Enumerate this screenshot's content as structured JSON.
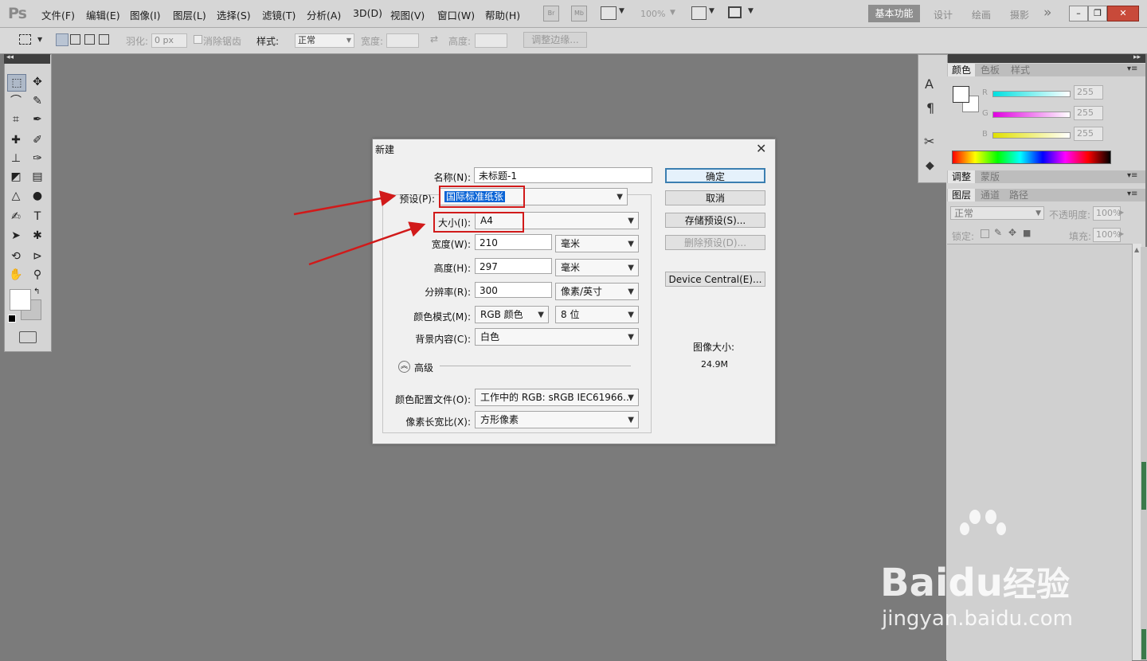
{
  "app": {
    "logo": "Ps"
  },
  "menubar": {
    "items": [
      "文件(F)",
      "编辑(E)",
      "图像(I)",
      "图层(L)",
      "选择(S)",
      "滤镜(T)",
      "分析(A)",
      "3D(D)",
      "视图(V)",
      "窗口(W)",
      "帮助(H)"
    ],
    "bridge_label": "Br",
    "minibridge_label": "Mb",
    "zoom": "100%",
    "workspaces": {
      "active": "基本功能",
      "others": [
        "设计",
        "绘画",
        "摄影"
      ]
    },
    "more": "»"
  },
  "options": {
    "feather_label": "羽化:",
    "feather_value": "0 px",
    "antialias_label": "消除锯齿",
    "style_label": "样式:",
    "style_value": "正常",
    "width_label": "宽度:",
    "height_label": "高度:",
    "refine_edge": "调整边缘..."
  },
  "right_panels": {
    "color_tabs": [
      "颜色",
      "色板",
      "样式"
    ],
    "r_label": "R",
    "g_label": "G",
    "b_label": "B",
    "r_value": "255",
    "g_value": "255",
    "b_value": "255",
    "adjust_tabs": [
      "调整",
      "蒙版"
    ],
    "layer_tabs": [
      "图层",
      "通道",
      "路径"
    ],
    "blend_mode": "正常",
    "opacity_label": "不透明度:",
    "opacity_value": "100%",
    "lock_label": "锁定:",
    "fill_label": "填充:",
    "fill_value": "100%"
  },
  "dialog": {
    "title": "新建",
    "name_label": "名称(N):",
    "name_value": "未标题-1",
    "preset_label": "预设(P):",
    "preset_value": "国际标准纸张",
    "size_label": "大小(I):",
    "size_value": "A4",
    "width_label": "宽度(W):",
    "width_value": "210",
    "width_unit": "毫米",
    "height_label": "高度(H):",
    "height_value": "297",
    "height_unit": "毫米",
    "resolution_label": "分辨率(R):",
    "resolution_value": "300",
    "resolution_unit": "像素/英寸",
    "color_mode_label": "颜色模式(M):",
    "color_mode_value": "RGB 颜色",
    "bit_depth_value": "8 位",
    "background_label": "背景内容(C):",
    "background_value": "白色",
    "advanced_label": "高级",
    "color_profile_label": "颜色配置文件(O):",
    "color_profile_value": "工作中的 RGB: sRGB IEC61966...",
    "pixel_aspect_label": "像素长宽比(X):",
    "pixel_aspect_value": "方形像素",
    "ok_label": "确定",
    "cancel_label": "取消",
    "save_preset_label": "存储预设(S)...",
    "delete_preset_label": "删除预设(D)...",
    "device_central_label": "Device Central(E)...",
    "image_size_label": "图像大小:",
    "image_size_value": "24.9M"
  },
  "watermark": {
    "brand_a": "Bai",
    "brand_b": "du",
    "brand_c": "经验",
    "url": "jingyan.baidu.com"
  },
  "colors": {
    "highlight": "#0a64d6",
    "annotation_red": "#d11a1a"
  }
}
